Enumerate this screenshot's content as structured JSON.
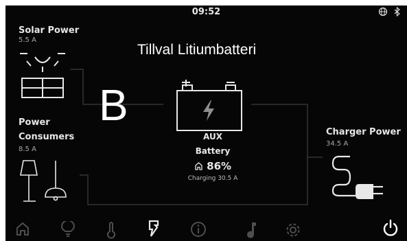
{
  "status": {
    "time": "09:52",
    "icons": [
      "globe-icon",
      "bluetooth-icon"
    ]
  },
  "overlay": {
    "title": "Tillval Litiumbatteri",
    "letter": "B"
  },
  "solar": {
    "title": "Solar Power",
    "value": "5.5 A",
    "icon": "sun-panel-icon"
  },
  "consumers": {
    "title_line1": "Power",
    "title_line2": "Consumers",
    "value": "8.5 A",
    "icon": "lamp-icon"
  },
  "battery": {
    "name_line1": "AUX",
    "name_line2": "Battery",
    "level": "86%",
    "status": "Charging 30.5 A",
    "icon": "battery-bolt-icon",
    "level_icon": "home-icon"
  },
  "charger": {
    "title": "Charger Power",
    "value": "34.5 A",
    "icon": "plug-icon"
  },
  "nav": {
    "items": [
      "home-icon",
      "bulb-icon",
      "thermometer-icon",
      "power-icon",
      "info-icon",
      "music-icon",
      "settings-icon"
    ],
    "active": "power-icon",
    "power_button": "power-button-icon"
  }
}
